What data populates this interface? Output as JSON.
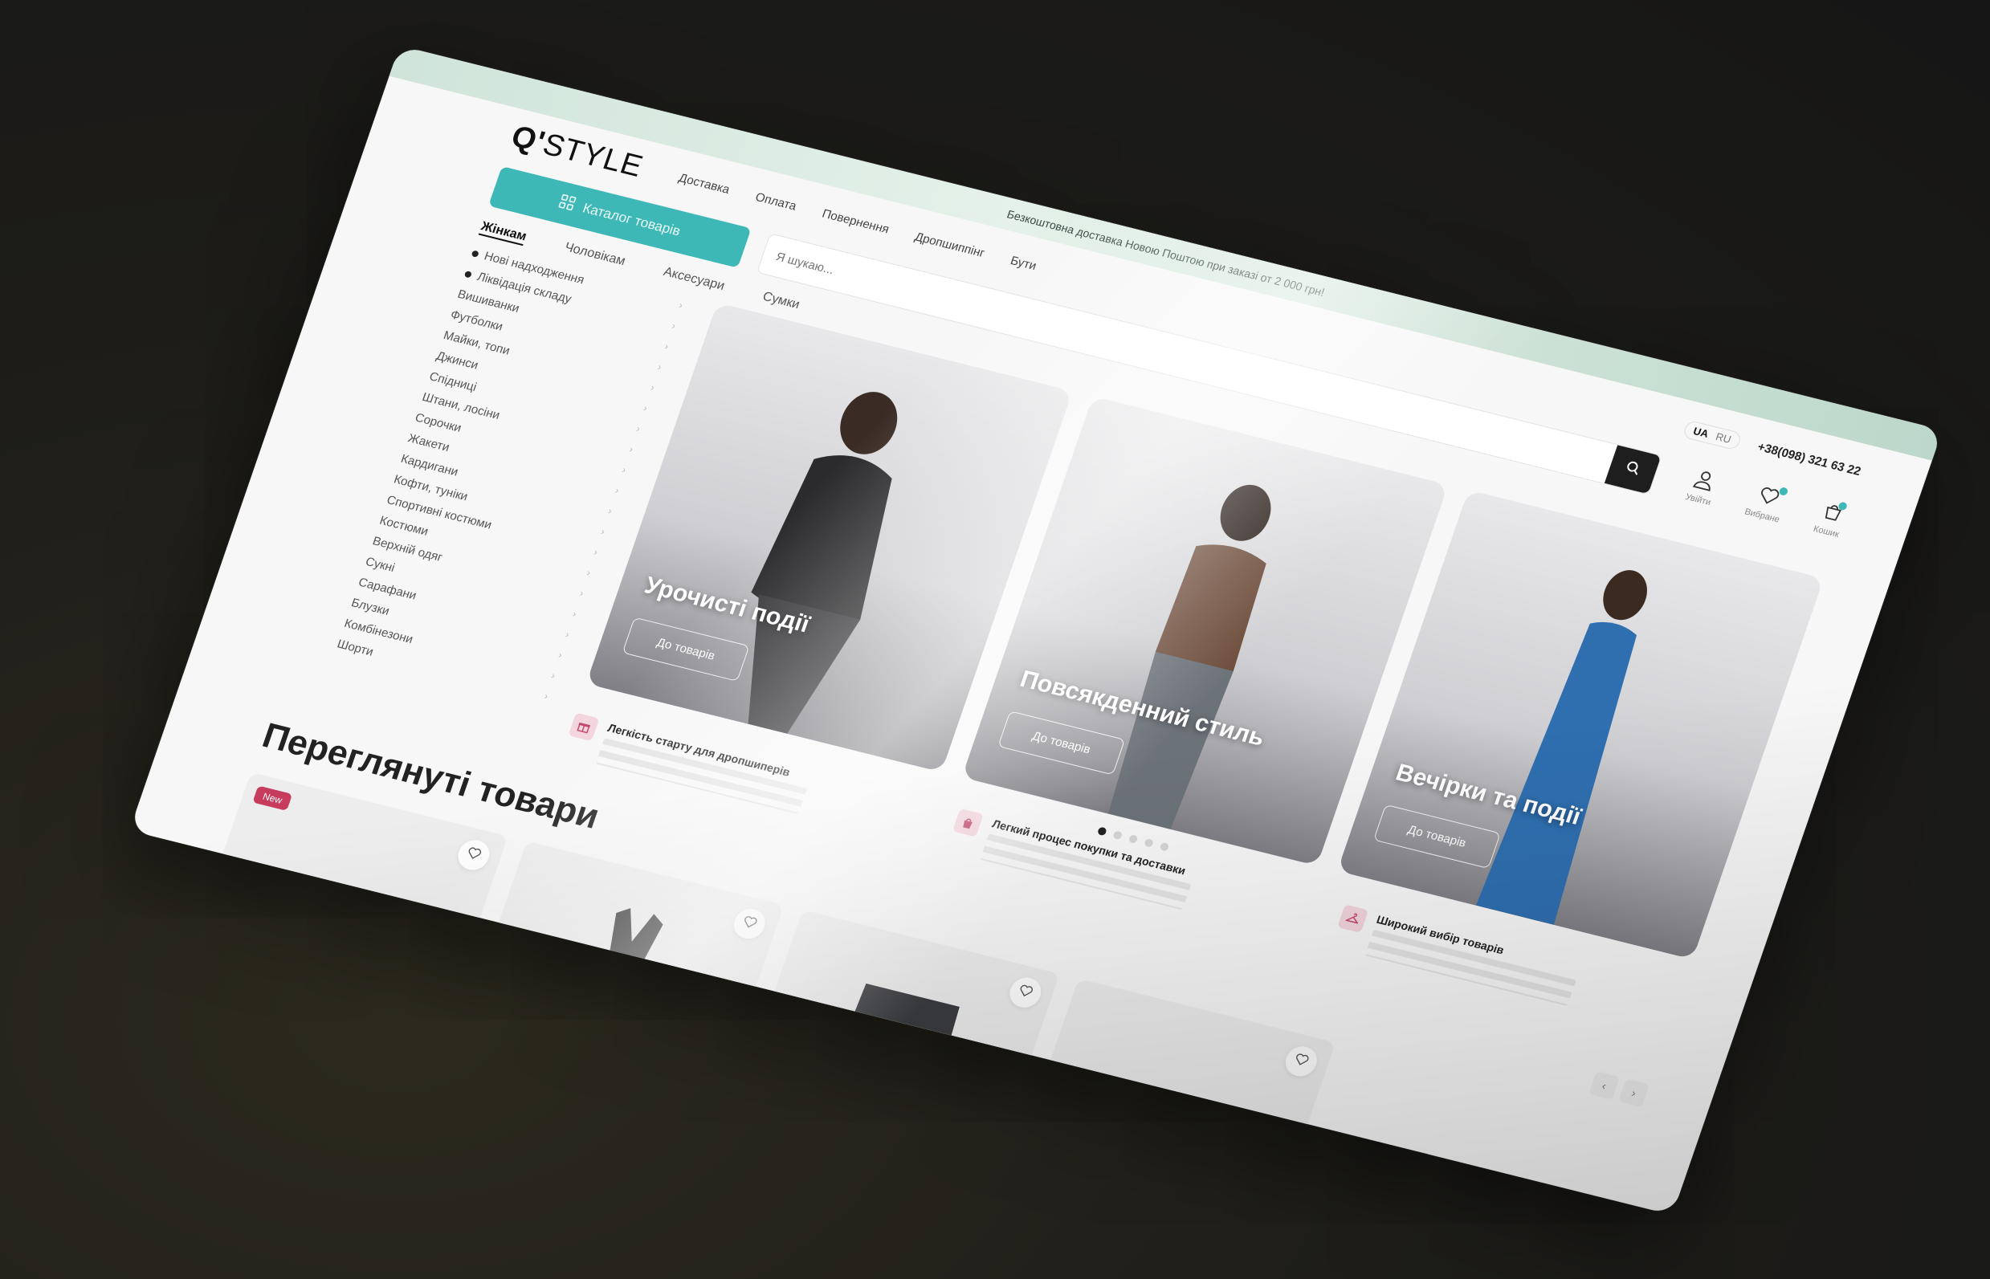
{
  "promo": {
    "text": "Безкоштовна доставка Новою Поштою при заказі от 2 000 грн!"
  },
  "header": {
    "logo_mark": "Q'",
    "logo_text": "STYLE",
    "nav": [
      "Доставка",
      "Оплата",
      "Повернення",
      "Дропшиппінг",
      "Бути"
    ],
    "lang": {
      "active": "UA",
      "other": "RU"
    },
    "phone": "+38(098) 321 63 22"
  },
  "toolbar": {
    "catalog_label": "Каталог товарів",
    "search_placeholder": "Я шукаю...",
    "icons": [
      {
        "name": "user-icon",
        "label": "Увійти"
      },
      {
        "name": "heart-icon",
        "label": "Вибране"
      },
      {
        "name": "cart-icon",
        "label": "Кошик"
      }
    ]
  },
  "categories": [
    "Жінкам",
    "Чоловікам",
    "Аксесуари",
    "Сумки"
  ],
  "sidebar": [
    {
      "label": "Нові надходження",
      "dot": true
    },
    {
      "label": "Ліквідація складу",
      "dot": true
    },
    {
      "label": "Вишиванки"
    },
    {
      "label": "Футболки"
    },
    {
      "label": "Майки, топи"
    },
    {
      "label": "Джинси"
    },
    {
      "label": "Спідниці"
    },
    {
      "label": "Штани, лосіни"
    },
    {
      "label": "Сорочки"
    },
    {
      "label": "Жакети"
    },
    {
      "label": "Кардигани"
    },
    {
      "label": "Кофти, туніки"
    },
    {
      "label": "Спортивні костюми"
    },
    {
      "label": "Костюми"
    },
    {
      "label": "Верхній одяг"
    },
    {
      "label": "Сукні"
    },
    {
      "label": "Сарафани"
    },
    {
      "label": "Блузки"
    },
    {
      "label": "Комбінезони"
    },
    {
      "label": "Шорти"
    }
  ],
  "banners": [
    {
      "title": "Урочисті події",
      "button": "До товарів",
      "color": "#2b2a2c"
    },
    {
      "title": "Повсякденний стиль",
      "button": "До товарів",
      "color": "#6e4e3c"
    },
    {
      "title": "Вечірки та події",
      "button": "До товарів",
      "color": "#2f6fb0"
    }
  ],
  "slider": {
    "total": 5,
    "active": 0
  },
  "features": [
    {
      "title": "Легкість старту для дропшиперів"
    },
    {
      "title": "Легкий процес покупки та доставки"
    },
    {
      "title": "Широкий вибір товарів"
    }
  ],
  "viewed": {
    "title": "Переглянуті товари",
    "prev": "‹",
    "next": "›",
    "products": [
      {
        "badge": "New",
        "kind": "skirt"
      },
      {
        "kind": "dress"
      },
      {
        "kind": "jeans"
      },
      {
        "kind": "bag"
      }
    ]
  },
  "colors": {
    "accent": "#3db8b6",
    "badge": "#c73b5c",
    "dark": "#1e1e1e"
  }
}
